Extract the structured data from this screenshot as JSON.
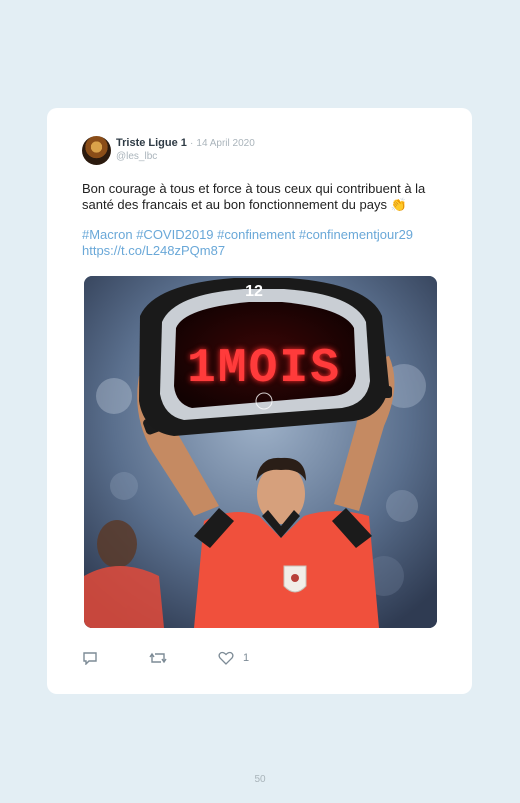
{
  "tweet": {
    "author_name": "Triste Ligue 1",
    "separator": "·",
    "date": "14 April 2020",
    "handle": "@les_lbc",
    "text": "Bon courage à tous et force à tous ceux qui contribuent à la santé des francais et au bon fonctionnement du pays",
    "emoji": "👏",
    "hashtags": [
      "#Macron",
      "#COVID2019",
      "#confinement",
      "#confinementjour29"
    ],
    "link": "https://t.co/L248zPQm87",
    "media": {
      "board_text": "1MOIS",
      "clock_number": "12"
    },
    "actions": {
      "likes": "1",
      "reply_icon": "reply-icon",
      "retweet_icon": "retweet-icon",
      "like_icon": "heart-icon"
    }
  },
  "page": {
    "number": "50"
  },
  "colors": {
    "background": "#e3eef4",
    "link": "#6aa8d8",
    "led": "#ff3b3b",
    "jersey": "#f0503c"
  }
}
